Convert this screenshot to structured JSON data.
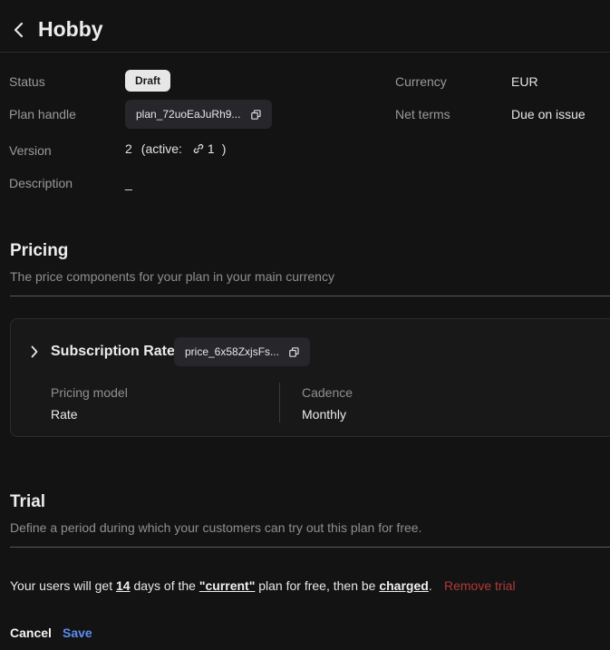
{
  "header": {
    "title": "Hobby"
  },
  "meta": {
    "status_label": "Status",
    "status_value": "Draft",
    "plan_handle_label": "Plan handle",
    "plan_handle_value": "plan_72uoEaJuRh9...",
    "version_label": "Version",
    "version_value": "2",
    "active_label": "(active:",
    "active_value": "1",
    "active_close": ")",
    "description_label": "Description",
    "description_value": "_",
    "currency_label": "Currency",
    "currency_value": "EUR",
    "net_terms_label": "Net terms",
    "net_terms_value": "Due on issue"
  },
  "pricing": {
    "title": "Pricing",
    "subtitle": "The price components for your plan in your main currency",
    "component": {
      "name": "Subscription Rate",
      "price_id": "price_6x58ZxjsFs...",
      "pricing_model_label": "Pricing model",
      "pricing_model_value": "Rate",
      "cadence_label": "Cadence",
      "cadence_value": "Monthly"
    }
  },
  "trial": {
    "title": "Trial",
    "subtitle": "Define a period during which your customers can try out this plan for free.",
    "sentence_p1": "Your users will get ",
    "days": "14",
    "sentence_p2": " days of the ",
    "plan": "\"current\"",
    "sentence_p3": " plan for free, then be ",
    "charged": "charged",
    "sentence_p4": ".",
    "remove_label": "Remove trial"
  },
  "actions": {
    "cancel_label": "Cancel",
    "save_label": "Save"
  },
  "icons": {
    "back": "chevron-left-icon",
    "copy": "copy-icon",
    "link": "link-icon",
    "expand": "chevron-right-icon"
  },
  "colors": {
    "background": "#131313",
    "accent_save": "#5b8ef0",
    "danger": "#b03a3a",
    "badge": "#e7e7e7",
    "chip": "#26262b"
  }
}
